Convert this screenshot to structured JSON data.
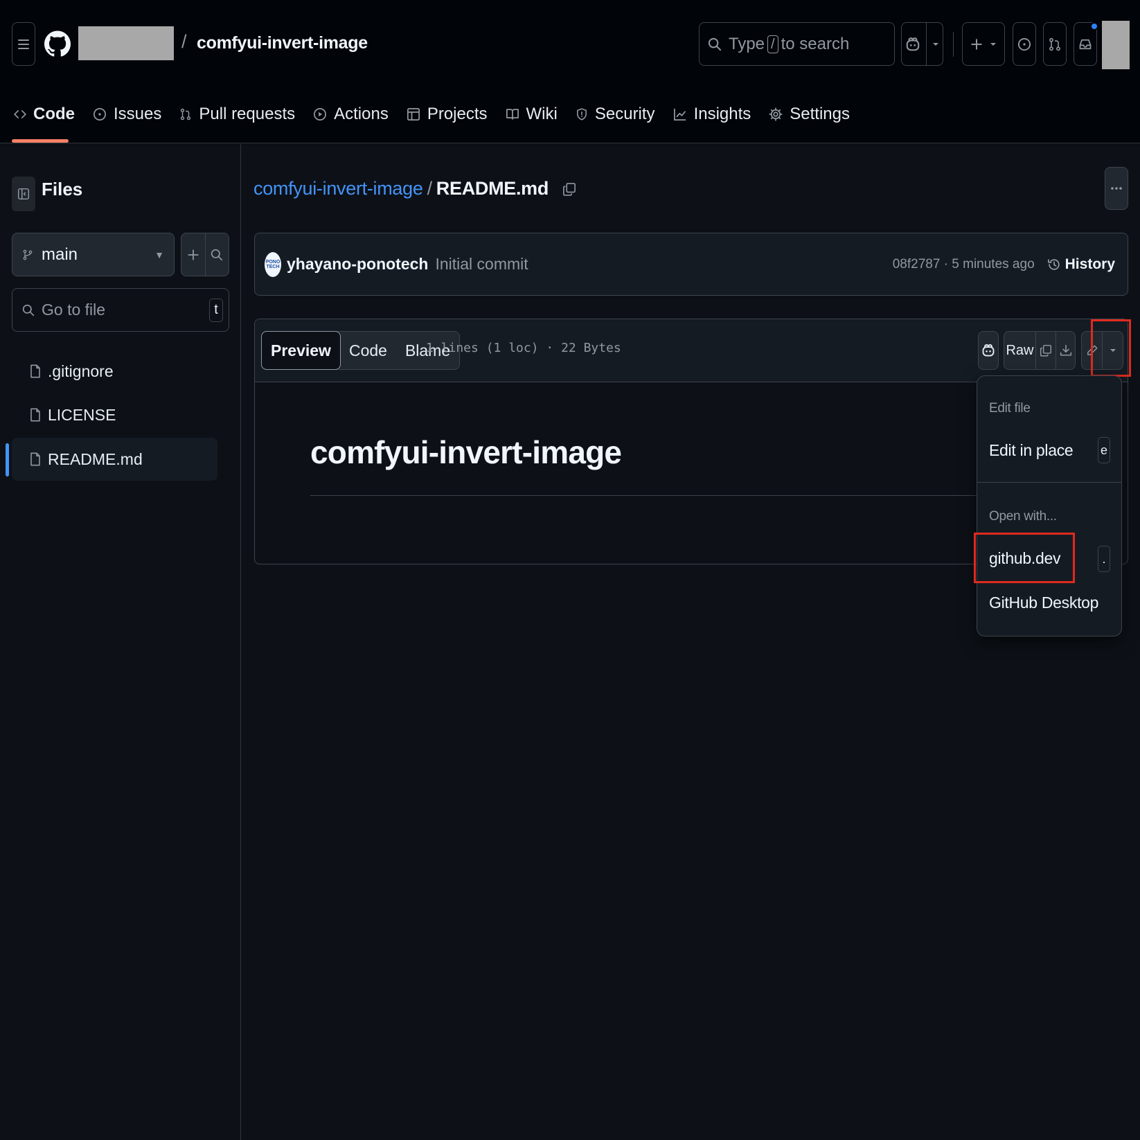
{
  "header": {
    "repo_name": "comfyui-invert-image",
    "path_separator": "/",
    "search": {
      "prefix": "Type",
      "key": "/",
      "suffix": "to search"
    }
  },
  "tabs": [
    {
      "label": "Code",
      "icon": "code-icon",
      "active": true
    },
    {
      "label": "Issues",
      "icon": "issue-icon"
    },
    {
      "label": "Pull requests",
      "icon": "pull-request-icon"
    },
    {
      "label": "Actions",
      "icon": "play-icon"
    },
    {
      "label": "Projects",
      "icon": "table-icon"
    },
    {
      "label": "Wiki",
      "icon": "book-icon"
    },
    {
      "label": "Security",
      "icon": "shield-icon"
    },
    {
      "label": "Insights",
      "icon": "graph-icon"
    },
    {
      "label": "Settings",
      "icon": "gear-icon"
    }
  ],
  "sidebar": {
    "title": "Files",
    "branch": "main",
    "goto_placeholder": "Go to file",
    "goto_key": "t",
    "files": [
      ".gitignore",
      "LICENSE",
      "README.md"
    ],
    "selected": "README.md"
  },
  "breadcrumb": {
    "repo": "comfyui-invert-image",
    "sep": "/",
    "file": "README.md"
  },
  "commit": {
    "avatar_text": "PONO TECH",
    "author": "yhayano-ponotech",
    "message": "Initial commit",
    "meta": "08f2787 · 5 minutes ago",
    "history_label": "History"
  },
  "file_view": {
    "tabs": [
      "Preview",
      "Code",
      "Blame"
    ],
    "active_tab": "Preview",
    "info": "1 lines (1 loc) · 22 Bytes",
    "raw_label": "Raw",
    "readme_heading": "comfyui-invert-image"
  },
  "dropdown": {
    "edit_section": "Edit file",
    "edit_in_place": "Edit in place",
    "edit_key": "e",
    "open_section": "Open with...",
    "github_dev": "github.dev",
    "github_dev_key": ".",
    "github_desktop": "GitHub Desktop"
  },
  "colors": {
    "accent_link": "#4493f8",
    "tab_underline": "#f78166",
    "highlight_box": "#e02a1f",
    "background": "#0d1117"
  }
}
